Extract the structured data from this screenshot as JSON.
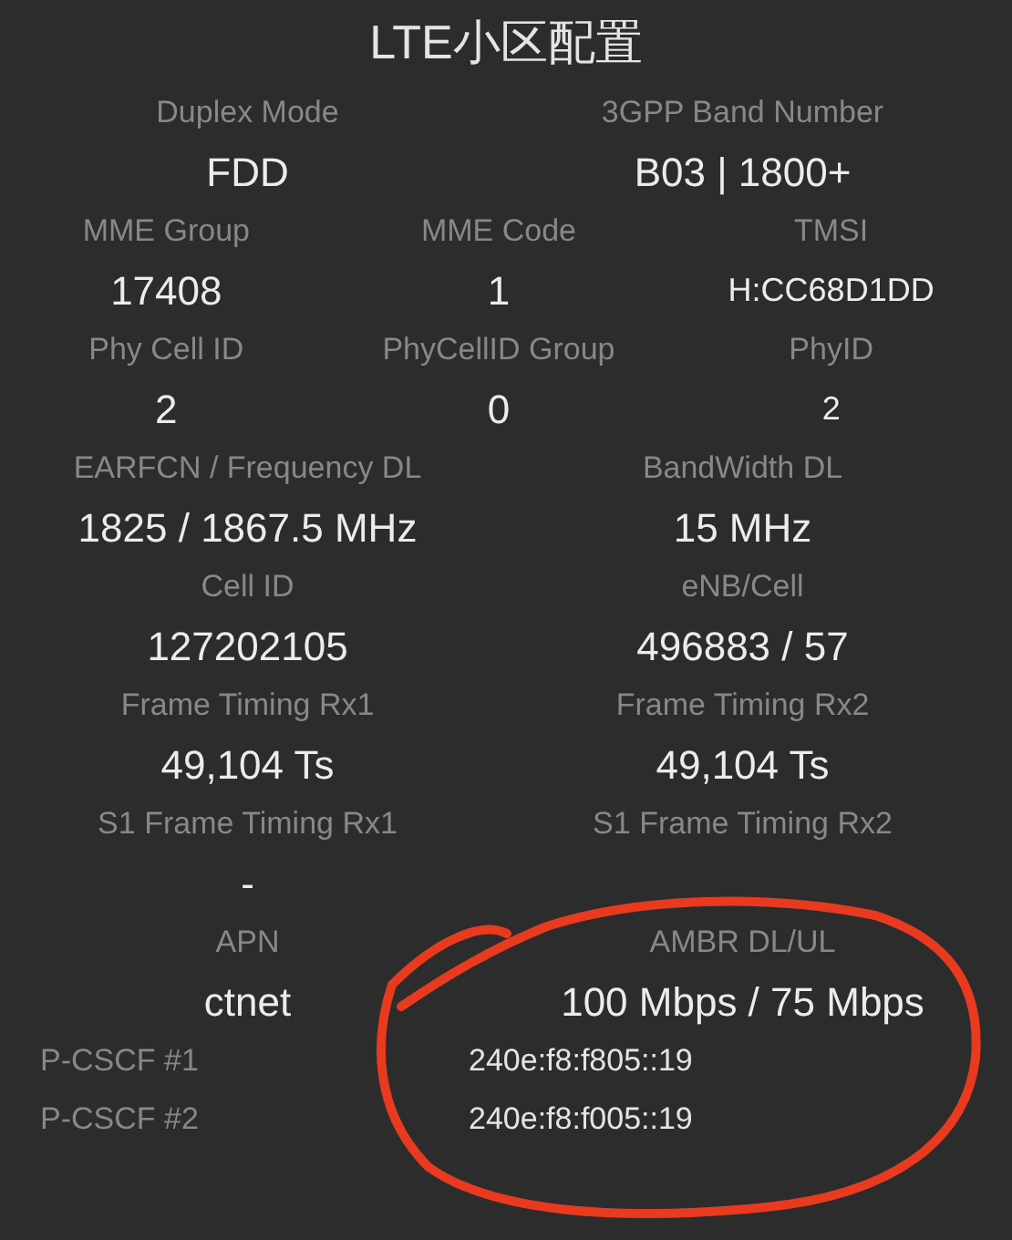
{
  "title": "LTE小区配置",
  "sections": [
    {
      "fields": [
        {
          "label": "Duplex Mode",
          "value": "FDD"
        },
        {
          "label": "3GPP Band Number",
          "value": "B03 | 1800+"
        }
      ]
    },
    {
      "fields": [
        {
          "label": "MME Group",
          "value": "17408"
        },
        {
          "label": "MME Code",
          "value": "1"
        },
        {
          "label": "TMSI",
          "value": "H:CC68D1DD"
        }
      ]
    },
    {
      "fields": [
        {
          "label": "Phy Cell ID",
          "value": "2"
        },
        {
          "label": "PhyCellID Group",
          "value": "0"
        },
        {
          "label": "PhyID",
          "value": "2"
        }
      ]
    },
    {
      "fields": [
        {
          "label": "EARFCN / Frequency DL",
          "value": "1825 / 1867.5 MHz"
        },
        {
          "label": "BandWidth DL",
          "value": "15 MHz"
        }
      ]
    },
    {
      "fields": [
        {
          "label": "Cell ID",
          "value": "127202105"
        },
        {
          "label": "eNB/Cell",
          "value": "496883 / 57"
        }
      ]
    },
    {
      "fields": [
        {
          "label": "Frame Timing Rx1",
          "value": "49,104 Ts"
        },
        {
          "label": "Frame Timing Rx2",
          "value": "49,104 Ts"
        }
      ]
    },
    {
      "fields": [
        {
          "label": "S1 Frame Timing Rx1",
          "value": "-"
        },
        {
          "label": "S1 Frame Timing Rx2"
        }
      ]
    },
    {
      "fields": [
        {
          "label": "APN",
          "value": "ctnet"
        },
        {
          "label": "AMBR DL/UL",
          "value": "100 Mbps / 75 Mbps"
        }
      ]
    }
  ],
  "pcscf": [
    {
      "label": "P-CSCF #1",
      "value": "240e:f8:f805::19"
    },
    {
      "label": "P-CSCF #2",
      "value": "240e:f8:f005::19"
    }
  ]
}
